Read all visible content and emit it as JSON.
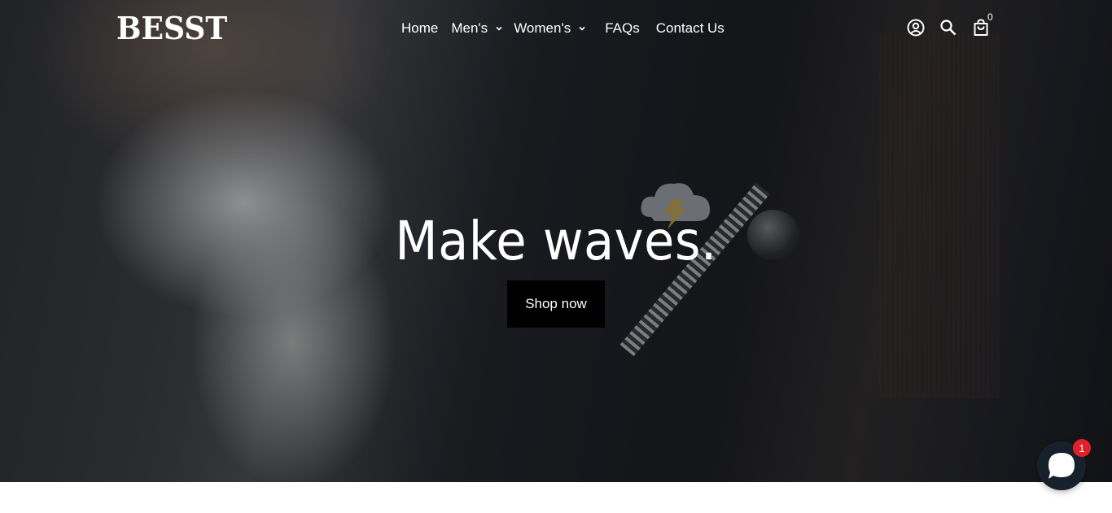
{
  "header": {
    "logo_text": "BESST",
    "nav": {
      "home": "Home",
      "mens": "Men's",
      "womens": "Women's",
      "faqs": "FAQs",
      "contact": "Contact Us"
    },
    "icons": {
      "account": "account-icon",
      "search": "search-icon",
      "cart": "cart-icon"
    },
    "cart_count": "0"
  },
  "hero": {
    "title": "Make waves.",
    "cta_label": "Shop now"
  },
  "chat": {
    "icon": "chat-icon",
    "badge_count": "1"
  },
  "colors": {
    "text": "#ffffff",
    "button_bg": "#000000",
    "chat_bg": "#17212b",
    "badge_bg": "#e0212b"
  }
}
